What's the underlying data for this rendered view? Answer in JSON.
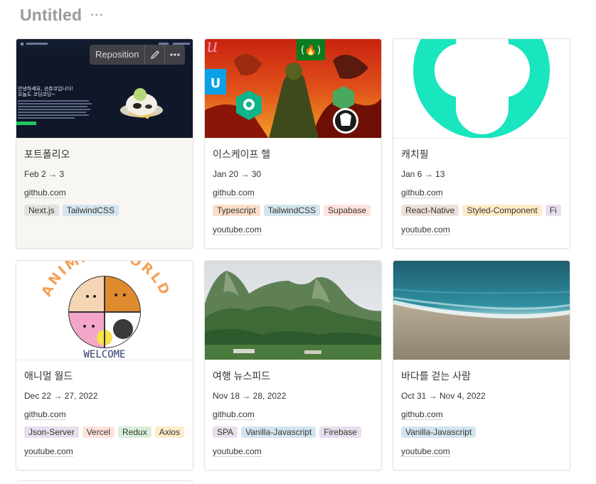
{
  "page": {
    "title": "Untitled",
    "more": "···"
  },
  "cover_controls": {
    "reposition": "Reposition"
  },
  "portfolio_cover": {
    "title_line1": "안녕하세요, 선츄코입니다!",
    "title_line2": "오늘도 코딩코딩~",
    "button": "포트폴리오 보러가기"
  },
  "animal_cover": {
    "arc": "ANIMAL WORLD",
    "bottom": "WELCOME"
  },
  "cards": [
    {
      "title": "포트폴리오",
      "date": "Feb 2 → 3",
      "link1": "github.com",
      "link2": "",
      "tags": [
        {
          "label": "Next.js",
          "color": "#e3e2e0"
        },
        {
          "label": "TailwindCSS",
          "color": "#d3e5ef"
        }
      ]
    },
    {
      "title": "이스케이프 헬",
      "date": "Jan 20 → 30",
      "link1": "github.com",
      "link2": "youtube.com",
      "tags": [
        {
          "label": "Typescript",
          "color": "#fadec9"
        },
        {
          "label": "TailwindCSS",
          "color": "#d3e5ef"
        },
        {
          "label": "Supabase",
          "color": "#ffe2dd"
        }
      ]
    },
    {
      "title": "캐치필",
      "date": "Jan 6 → 13",
      "link1": "github.com",
      "link2": "youtube.com",
      "tags": [
        {
          "label": "React-Native",
          "color": "#eee0da"
        },
        {
          "label": "Styled-Component",
          "color": "#fdecc8"
        },
        {
          "label": "Fi",
          "color": "#e8deee"
        }
      ]
    },
    {
      "title": "애니멀 월드",
      "date": "Dec 22 → 27, 2022",
      "link1": "github.com",
      "link2": "youtube.com",
      "tags": [
        {
          "label": "Json-Server",
          "color": "#e8deee"
        },
        {
          "label": "Vercel",
          "color": "#ffe2dd"
        },
        {
          "label": "Redux",
          "color": "#dbeddb"
        },
        {
          "label": "Axios",
          "color": "#fdecc8"
        }
      ]
    },
    {
      "title": "여행 뉴스피드",
      "date": "Nov 18 → 28, 2022",
      "link1": "github.com",
      "link2": "youtube.com",
      "tags": [
        {
          "label": "SPA",
          "color": "#e8deee"
        },
        {
          "label": "Vanilla-Javascript",
          "color": "#d3e5ef"
        },
        {
          "label": "Firebase",
          "color": "#e8deee"
        }
      ]
    },
    {
      "title": "바다를 걷는 사람",
      "date": "Oct 31 → Nov 4, 2022",
      "link1": "github.com",
      "link2": "youtube.com",
      "tags": [
        {
          "label": "Vanilla-Javascript",
          "color": "#d3e5ef"
        }
      ]
    }
  ]
}
